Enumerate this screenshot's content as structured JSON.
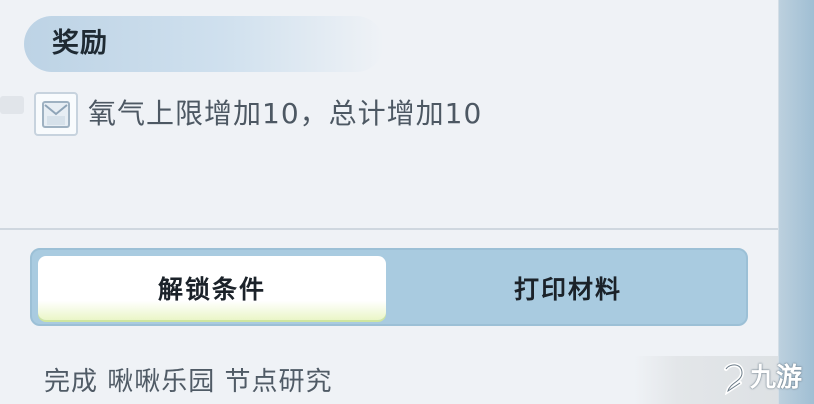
{
  "reward": {
    "title": "奖励",
    "item_icon": "oxygen-tank-icon",
    "item_text": "氧气上限增加10，总计增加10"
  },
  "tabs": [
    {
      "label": "解锁条件",
      "active": true
    },
    {
      "label": "打印材料",
      "active": false
    }
  ],
  "condition": {
    "text": "完成 啾啾乐园 节点研究"
  },
  "watermark": {
    "text": "九游",
    "icon": "jiuyou-logo-icon"
  },
  "colors": {
    "panel_bg": "#eff2f6",
    "tab_bar": "#a9cbe0",
    "tab_active": "#ffffff",
    "header_pill": "#bdd3e5"
  }
}
